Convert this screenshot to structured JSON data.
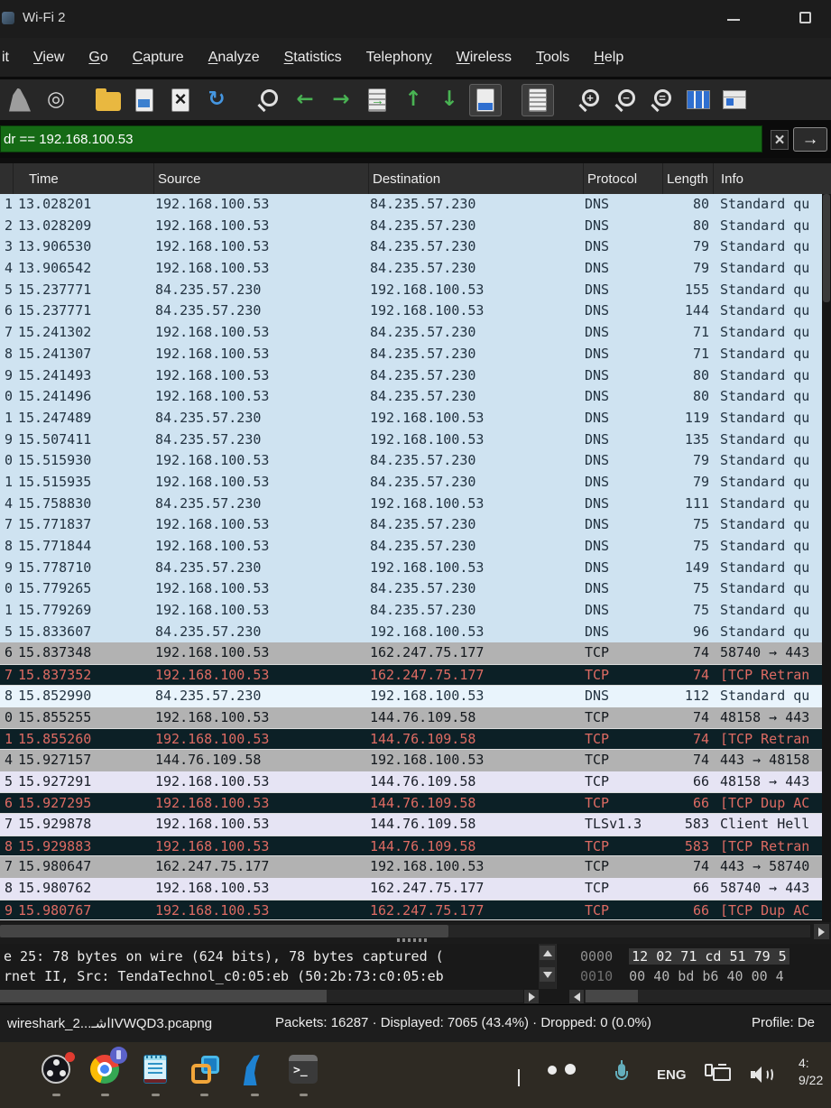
{
  "window": {
    "title": "Wi-Fi 2"
  },
  "menu": {
    "items": [
      {
        "label": "it",
        "u": -1
      },
      {
        "label": "View",
        "u": 0
      },
      {
        "label": "Go",
        "u": 0
      },
      {
        "label": "Capture",
        "u": 0
      },
      {
        "label": "Analyze",
        "u": 0
      },
      {
        "label": "Statistics",
        "u": 0
      },
      {
        "label": "Telephony",
        "u": 8
      },
      {
        "label": "Wireless",
        "u": 0
      },
      {
        "label": "Tools",
        "u": 0
      },
      {
        "label": "Help",
        "u": 0
      }
    ]
  },
  "toolbar": {
    "icons": [
      {
        "name": "start-capture-icon",
        "type": "fin"
      },
      {
        "name": "capture-options-icon",
        "type": "glyph",
        "glyph": "◎",
        "color": "#d8d8d8"
      },
      {
        "name": "open-capture-icon",
        "type": "folder",
        "gap": true
      },
      {
        "name": "save-capture-icon",
        "type": "doc-save"
      },
      {
        "name": "close-capture-icon",
        "type": "doc-close"
      },
      {
        "name": "reload-capture-icon",
        "type": "glyph",
        "glyph": "↻",
        "color": "#4596e0"
      },
      {
        "name": "find-packet-icon",
        "type": "mag",
        "sub": "",
        "gap": true
      },
      {
        "name": "go-back-icon",
        "type": "glyph",
        "glyph": "←",
        "color": "#49b353"
      },
      {
        "name": "go-forward-icon",
        "type": "glyph",
        "glyph": "→",
        "color": "#49b353"
      },
      {
        "name": "go-to-packet-icon",
        "type": "doc-goto"
      },
      {
        "name": "go-first-packet-icon",
        "type": "glyph",
        "glyph": "↑",
        "color": "#49b353"
      },
      {
        "name": "go-last-packet-icon",
        "type": "glyph",
        "glyph": "↓",
        "color": "#49b353"
      },
      {
        "name": "auto-scroll-icon",
        "type": "autoscroll",
        "pressed": true
      },
      {
        "name": "colorize-packets-icon",
        "type": "colorize",
        "pressed": true,
        "gap": true
      },
      {
        "name": "zoom-in-icon",
        "type": "mag",
        "sub": "+",
        "gap": true
      },
      {
        "name": "zoom-out-icon",
        "type": "mag",
        "sub": "−"
      },
      {
        "name": "zoom-100-icon",
        "type": "mag",
        "sub": "="
      },
      {
        "name": "resize-columns-icon",
        "type": "cols"
      },
      {
        "name": "reset-layout-icon",
        "type": "cols-alt"
      }
    ]
  },
  "filter": {
    "value": "dr == 192.168.100.53",
    "clear_glyph": "×",
    "apply_glyph": "→"
  },
  "table": {
    "columns": [
      "Time",
      "Source",
      "Destination",
      "Protocol",
      "Length",
      "Info"
    ],
    "rows": [
      [
        "1",
        "13.028201",
        "192.168.100.53",
        "84.235.57.230",
        "DNS",
        "80",
        "Standard qu",
        "dns"
      ],
      [
        "2",
        "13.028209",
        "192.168.100.53",
        "84.235.57.230",
        "DNS",
        "80",
        "Standard qu",
        "dns"
      ],
      [
        "3",
        "13.906530",
        "192.168.100.53",
        "84.235.57.230",
        "DNS",
        "79",
        "Standard qu",
        "dns"
      ],
      [
        "4",
        "13.906542",
        "192.168.100.53",
        "84.235.57.230",
        "DNS",
        "79",
        "Standard qu",
        "dns"
      ],
      [
        "5",
        "15.237771",
        "84.235.57.230",
        "192.168.100.53",
        "DNS",
        "155",
        "Standard qu",
        "dns"
      ],
      [
        "6",
        "15.237771",
        "84.235.57.230",
        "192.168.100.53",
        "DNS",
        "144",
        "Standard qu",
        "dns"
      ],
      [
        "7",
        "15.241302",
        "192.168.100.53",
        "84.235.57.230",
        "DNS",
        "71",
        "Standard qu",
        "dns"
      ],
      [
        "8",
        "15.241307",
        "192.168.100.53",
        "84.235.57.230",
        "DNS",
        "71",
        "Standard qu",
        "dns"
      ],
      [
        "9",
        "15.241493",
        "192.168.100.53",
        "84.235.57.230",
        "DNS",
        "80",
        "Standard qu",
        "dns"
      ],
      [
        "0",
        "15.241496",
        "192.168.100.53",
        "84.235.57.230",
        "DNS",
        "80",
        "Standard qu",
        "dns"
      ],
      [
        "1",
        "15.247489",
        "84.235.57.230",
        "192.168.100.53",
        "DNS",
        "119",
        "Standard qu",
        "dns"
      ],
      [
        "9",
        "15.507411",
        "84.235.57.230",
        "192.168.100.53",
        "DNS",
        "135",
        "Standard qu",
        "dns"
      ],
      [
        "0",
        "15.515930",
        "192.168.100.53",
        "84.235.57.230",
        "DNS",
        "79",
        "Standard qu",
        "dns"
      ],
      [
        "1",
        "15.515935",
        "192.168.100.53",
        "84.235.57.230",
        "DNS",
        "79",
        "Standard qu",
        "dns"
      ],
      [
        "4",
        "15.758830",
        "84.235.57.230",
        "192.168.100.53",
        "DNS",
        "111",
        "Standard qu",
        "dns"
      ],
      [
        "7",
        "15.771837",
        "192.168.100.53",
        "84.235.57.230",
        "DNS",
        "75",
        "Standard qu",
        "dns"
      ],
      [
        "8",
        "15.771844",
        "192.168.100.53",
        "84.235.57.230",
        "DNS",
        "75",
        "Standard qu",
        "dns"
      ],
      [
        "9",
        "15.778710",
        "84.235.57.230",
        "192.168.100.53",
        "DNS",
        "149",
        "Standard qu",
        "dns"
      ],
      [
        "0",
        "15.779265",
        "192.168.100.53",
        "84.235.57.230",
        "DNS",
        "75",
        "Standard qu",
        "dns"
      ],
      [
        "1",
        "15.779269",
        "192.168.100.53",
        "84.235.57.230",
        "DNS",
        "75",
        "Standard qu",
        "dns"
      ],
      [
        "5",
        "15.833607",
        "84.235.57.230",
        "192.168.100.53",
        "DNS",
        "96",
        "Standard qu",
        "dns"
      ],
      [
        "6",
        "15.837348",
        "192.168.100.53",
        "162.247.75.177",
        "TCP",
        "74",
        "58740 → 443",
        "gray"
      ],
      [
        "7",
        "15.837352",
        "192.168.100.53",
        "162.247.75.177",
        "TCP",
        "74",
        "[TCP Retran",
        "bad"
      ],
      [
        "8",
        "15.852990",
        "84.235.57.230",
        "192.168.100.53",
        "DNS",
        "112",
        "Standard qu",
        "dns2"
      ],
      [
        "0",
        "15.855255",
        "192.168.100.53",
        "144.76.109.58",
        "TCP",
        "74",
        "48158 → 443",
        "gray"
      ],
      [
        "1",
        "15.855260",
        "192.168.100.53",
        "144.76.109.58",
        "TCP",
        "74",
        "[TCP Retran",
        "bad"
      ],
      [
        "4",
        "15.927157",
        "144.76.109.58",
        "192.168.100.53",
        "TCP",
        "74",
        "443 → 48158",
        "gray"
      ],
      [
        "5",
        "15.927291",
        "192.168.100.53",
        "144.76.109.58",
        "TCP",
        "66",
        "48158 → 443",
        "lav"
      ],
      [
        "6",
        "15.927295",
        "192.168.100.53",
        "144.76.109.58",
        "TCP",
        "66",
        "[TCP Dup AC",
        "bad"
      ],
      [
        "7",
        "15.929878",
        "192.168.100.53",
        "144.76.109.58",
        "TLSv1.3",
        "583",
        "Client Hell",
        "lav"
      ],
      [
        "8",
        "15.929883",
        "192.168.100.53",
        "144.76.109.58",
        "TCP",
        "583",
        "[TCP Retran",
        "bad"
      ],
      [
        "7",
        "15.980647",
        "162.247.75.177",
        "192.168.100.53",
        "TCP",
        "74",
        "443 → 58740",
        "gray"
      ],
      [
        "8",
        "15.980762",
        "192.168.100.53",
        "162.247.75.177",
        "TCP",
        "66",
        "58740 → 443",
        "lav"
      ],
      [
        "9",
        "15.980767",
        "192.168.100.53",
        "162.247.75.177",
        "TCP",
        "66",
        "[TCP Dup AC",
        "bad"
      ]
    ]
  },
  "details": {
    "lines": [
      "e 25: 78 bytes on wire (624 bits), 78 bytes captured (",
      "rnet II, Src: TendaTechnol_c0:05:eb (50:2b:73:c0:05:eb"
    ]
  },
  "hex": {
    "rows": [
      {
        "offset": "0000",
        "bytes": "12 02 71 cd 51 79 5"
      },
      {
        "offset": "0010",
        "bytes": "00 40 bd b6 40 00 4"
      }
    ]
  },
  "statusbar": {
    "file": "wireshark_2...اشـIVWQD3.pcapng",
    "stats": "Packets: 16287 · Displayed: 7065 (43.4%) · Dropped: 0 (0.0%)",
    "profile": "Profile: De"
  },
  "taskbar": {
    "language": "ENG",
    "clock_time": "4:",
    "clock_date": "9/22",
    "apps": [
      "orange-app",
      "obs",
      "chrome",
      "notepad",
      "vmware",
      "wireshark",
      "terminal"
    ]
  },
  "colors": {
    "filter_valid_bg": "#156a15",
    "dns_row": "#cfe3f1",
    "dns_row_light": "#e9f4fc",
    "tcp_syn_row": "#b2b2b2",
    "tcp_row": "#e6e4f4",
    "bad_tcp_bg": "#0c2026",
    "bad_tcp_text": "#de6b63",
    "header_bg": "#2f2f2f",
    "accent_blue": "#2f6fd0"
  }
}
